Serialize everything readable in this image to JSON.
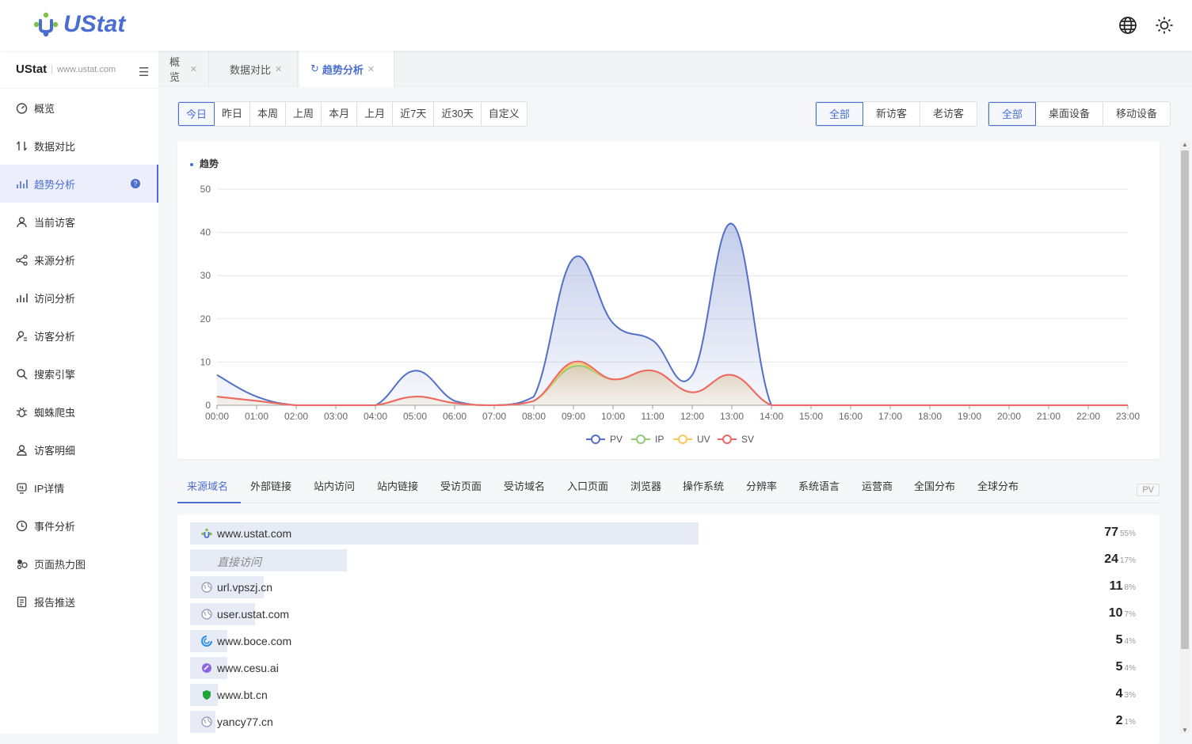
{
  "app": {
    "name": "UStat"
  },
  "site": {
    "name": "UStat",
    "url": "www.ustat.com"
  },
  "header": {
    "icons": [
      "globe-icon",
      "sun-icon"
    ]
  },
  "nav": [
    {
      "label": "概览",
      "icon": "dashboard-icon"
    },
    {
      "label": "数据对比",
      "icon": "compare-icon"
    },
    {
      "label": "趋势分析",
      "icon": "trend-icon",
      "active": true
    },
    {
      "label": "当前访客",
      "icon": "user-icon"
    },
    {
      "label": "来源分析",
      "icon": "share-icon"
    },
    {
      "label": "访问分析",
      "icon": "bar-icon"
    },
    {
      "label": "访客分析",
      "icon": "user-search-icon"
    },
    {
      "label": "搜索引擎",
      "icon": "search-icon"
    },
    {
      "label": "蜘蛛爬虫",
      "icon": "bug-icon"
    },
    {
      "label": "访客明细",
      "icon": "user-detail-icon"
    },
    {
      "label": "IP详情",
      "icon": "ip-icon"
    },
    {
      "label": "事件分析",
      "icon": "clock-icon"
    },
    {
      "label": "页面热力图",
      "icon": "heatmap-icon"
    },
    {
      "label": "报告推送",
      "icon": "report-icon"
    }
  ],
  "tabs": [
    {
      "label": "概览"
    },
    {
      "label": "数据对比"
    },
    {
      "label": "趋势分析",
      "active": true
    }
  ],
  "date_range": [
    "今日",
    "昨日",
    "本周",
    "上周",
    "本月",
    "上月",
    "近7天",
    "近30天",
    "自定义"
  ],
  "visitor_type": [
    "全部",
    "新访客",
    "老访客"
  ],
  "device_type": [
    "全部",
    "桌面设备",
    "移动设备"
  ],
  "chart_title": "趋势",
  "chart_data": {
    "type": "area",
    "title": "趋势",
    "x": [
      "00:00",
      "01:00",
      "02:00",
      "03:00",
      "04:00",
      "05:00",
      "06:00",
      "07:00",
      "08:00",
      "09:00",
      "10:00",
      "11:00",
      "12:00",
      "13:00",
      "14:00",
      "15:00",
      "16:00",
      "17:00",
      "18:00",
      "19:00",
      "20:00",
      "21:00",
      "22:00",
      "23:00"
    ],
    "ylim": [
      0,
      50
    ],
    "yticks": [
      0,
      10,
      20,
      30,
      40,
      50
    ],
    "grid": true,
    "legend": "bottom",
    "series": [
      {
        "name": "PV",
        "color": "#5470c6",
        "values": [
          7,
          2,
          0,
          0,
          0,
          8,
          1,
          0,
          2,
          34,
          19,
          15,
          7,
          42,
          0,
          0,
          0,
          0,
          0,
          0,
          0,
          0,
          0,
          0
        ]
      },
      {
        "name": "IP",
        "color": "#91cc75",
        "values": [
          2,
          1,
          0,
          0,
          0,
          2,
          0.5,
          0,
          1,
          9,
          6,
          8,
          3,
          7,
          0,
          0,
          0,
          0,
          0,
          0,
          0,
          0,
          0,
          0
        ]
      },
      {
        "name": "UV",
        "color": "#fac858",
        "values": [
          2,
          1,
          0,
          0,
          0,
          2,
          0.5,
          0,
          1,
          9.5,
          6,
          8,
          3,
          7,
          0,
          0,
          0,
          0,
          0,
          0,
          0,
          0,
          0,
          0
        ]
      },
      {
        "name": "SV",
        "color": "#ee6666",
        "values": [
          2,
          1,
          0,
          0,
          0,
          2,
          0.5,
          0,
          1,
          10,
          6,
          8,
          3,
          7,
          0,
          0,
          0,
          0,
          0,
          0,
          0,
          0,
          0,
          0
        ]
      }
    ]
  },
  "detail_tabs": [
    "来源域名",
    "外部链接",
    "站内访问",
    "站内链接",
    "受访页面",
    "受访域名",
    "入口页面",
    "浏览器",
    "操作系统",
    "分辨率",
    "系统语言",
    "运营商",
    "全国分布",
    "全球分布"
  ],
  "metric_badge": "PV",
  "sources": [
    {
      "label": "www.ustat.com",
      "value": "77",
      "pct": "55%",
      "share": 0.55,
      "icon": "ustat-icon"
    },
    {
      "label": "直接访问",
      "value": "24",
      "pct": "17%",
      "share": 0.17,
      "icon": "",
      "italic": true
    },
    {
      "label": "url.vpszj.cn",
      "value": "11",
      "pct": "8%",
      "share": 0.08,
      "icon": "globe-icon"
    },
    {
      "label": "user.ustat.com",
      "value": "10",
      "pct": "7%",
      "share": 0.07,
      "icon": "globe-icon"
    },
    {
      "label": "www.boce.com",
      "value": "5",
      "pct": "4%",
      "share": 0.04,
      "icon": "boce-icon"
    },
    {
      "label": "www.cesu.ai",
      "value": "5",
      "pct": "4%",
      "share": 0.04,
      "icon": "cesu-icon"
    },
    {
      "label": "www.bt.cn",
      "value": "4",
      "pct": "3%",
      "share": 0.03,
      "icon": "bt-icon"
    },
    {
      "label": "yancy77.cn",
      "value": "2",
      "pct": "1%",
      "share": 0.01,
      "icon": "globe-icon"
    }
  ]
}
